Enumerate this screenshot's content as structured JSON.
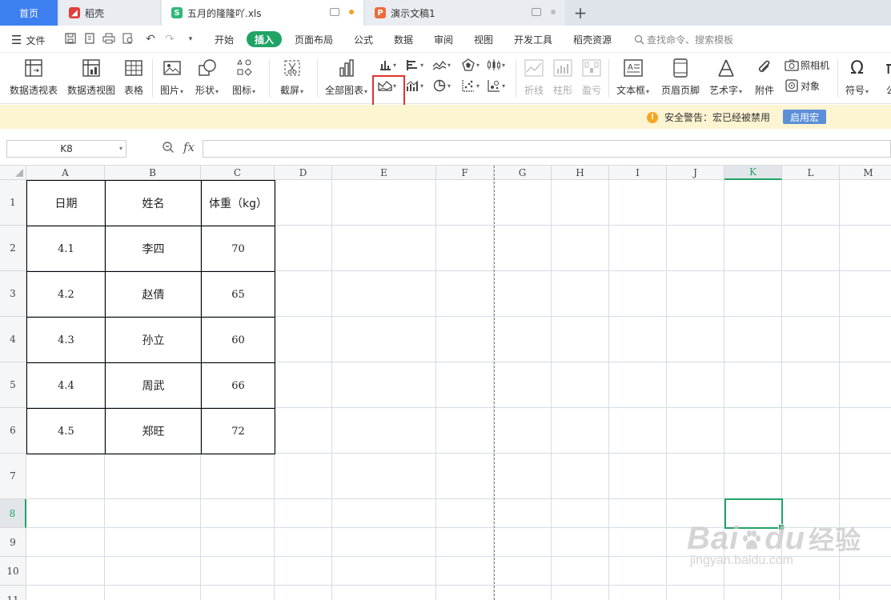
{
  "tabs": {
    "home": "首页",
    "daoke": "稻壳",
    "xls": "五月的隆隆吖.xls",
    "ppt": "演示文稿1",
    "add": "+"
  },
  "menu": {
    "file": "文件",
    "items": [
      "开始",
      "插入",
      "页面布局",
      "公式",
      "数据",
      "审阅",
      "视图",
      "开发工具",
      "稻壳资源"
    ],
    "search": "查找命令、搜索模板"
  },
  "ribbon": {
    "pivot_table": "数据透视表",
    "pivot_chart": "数据透视图",
    "table": "表格",
    "picture": "图片",
    "shape": "形状",
    "icon": "图标",
    "screenshot": "截屏",
    "all_charts": "全部图表",
    "sparkline_line": "折线",
    "sparkline_column": "柱形",
    "sparkline_winloss": "盈亏",
    "textbox": "文本框",
    "header_footer": "页眉页脚",
    "wordart": "艺术字",
    "attachment": "附件",
    "camera": "照相机",
    "object": "对象",
    "symbol": "符号",
    "formula_partial": "公"
  },
  "security": {
    "warning": "安全警告：宏已经被禁用",
    "enable_button": "启用宏"
  },
  "formula_bar": {
    "name_box": "K8",
    "fx": "fx",
    "formula": ""
  },
  "grid": {
    "columns": [
      "A",
      "B",
      "C",
      "D",
      "E",
      "F",
      "G",
      "H",
      "I",
      "J",
      "K",
      "L",
      "M"
    ],
    "rows": [
      "1",
      "2",
      "3",
      "4",
      "5",
      "6",
      "7",
      "8",
      "9",
      "10",
      "11"
    ],
    "selected_cell": "K8"
  },
  "table": {
    "headers": [
      "日期",
      "姓名",
      "体重（kg）"
    ],
    "rows": [
      [
        "4.1",
        "李四",
        "70"
      ],
      [
        "4.2",
        "赵倩",
        "65"
      ],
      [
        "4.3",
        "孙立",
        "60"
      ],
      [
        "4.4",
        "周武",
        "66"
      ],
      [
        "4.5",
        "郑旺",
        "72"
      ]
    ]
  },
  "watermark": {
    "logo": "Bai du 经验",
    "url": "jingyan.baidu.com"
  },
  "colors": {
    "accent_green": "#21a366",
    "home_tab_blue": "#3d7ff0",
    "highlight_red": "#e0332f",
    "security_bg": "#fdf4d2"
  }
}
